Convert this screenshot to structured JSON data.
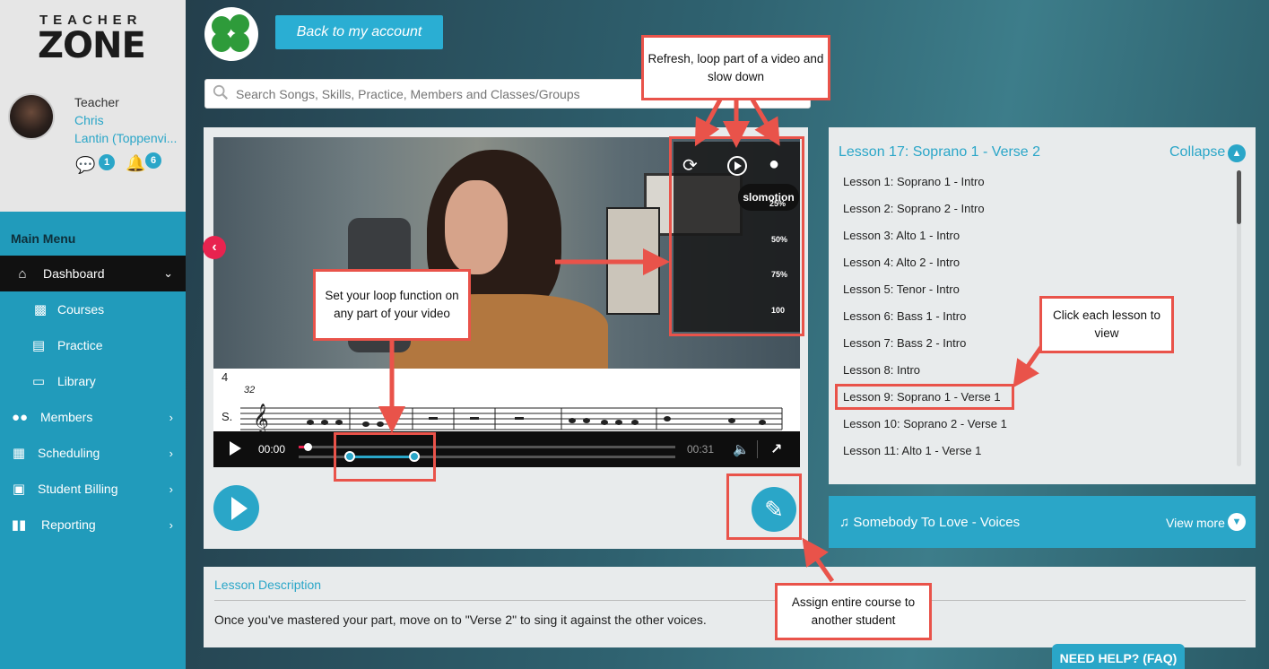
{
  "brand": {
    "logo_top": "TEACHER",
    "logo_main": "ZONE"
  },
  "user": {
    "role": "Teacher",
    "name_line1": "Chris",
    "name_line2": "Lantin (Toppenvi...",
    "messages_count": "1",
    "notifications_count": "6"
  },
  "menu": {
    "title": "Main Menu",
    "items": [
      {
        "label": "Dashboard",
        "icon": "home-icon"
      },
      {
        "label": "Courses",
        "icon": "book-icon"
      },
      {
        "label": "Practice",
        "icon": "document-icon"
      },
      {
        "label": "Library",
        "icon": "file-icon"
      },
      {
        "label": "Members",
        "icon": "users-icon"
      },
      {
        "label": "Scheduling",
        "icon": "calendar-icon"
      },
      {
        "label": "Student Billing",
        "icon": "cart-icon"
      },
      {
        "label": "Reporting",
        "icon": "bar-chart-icon"
      }
    ]
  },
  "header": {
    "back_button": "Back to my account",
    "search_placeholder": "Search Songs, Skills, Practice, Members and Classes/Groups"
  },
  "player": {
    "current_time": "00:00",
    "duration": "00:31",
    "slomo_tooltip": "slomotion",
    "speeds": [
      "25%",
      "50%",
      "75%",
      "100"
    ],
    "sheet_measure": "4",
    "sheet_bar": "32",
    "sheet_part": "S."
  },
  "lessons": {
    "current": "Lesson 17: Soprano 1 - Verse 2",
    "collapse_label": "Collapse",
    "items": [
      "Lesson 1: Soprano 1 - Intro",
      "Lesson 2: Soprano 2 - Intro",
      "Lesson 3: Alto 1 - Intro",
      "Lesson 4: Alto 2 - Intro",
      "Lesson 5: Tenor - Intro",
      "Lesson 6: Bass 1 - Intro",
      "Lesson 7: Bass 2 - Intro",
      "Lesson 8: Intro",
      "Lesson 9: Soprano 1 - Verse 1",
      "Lesson 10: Soprano 2 - Verse 1",
      "Lesson 11: Alto 1 - Verse 1"
    ]
  },
  "song": {
    "title": "Somebody To Love - Voices",
    "view_more": "View more"
  },
  "description": {
    "title": "Lesson Description",
    "text": "Once you've mastered your part, move on to \"Verse 2\" to sing it against the other voices."
  },
  "help": {
    "label": "NEED HELP? (FAQ)"
  },
  "callouts": {
    "refresh": "Refresh, loop part of a video and slow down",
    "loop": "Set your loop function on any part of your video",
    "click_lesson": "Click each lesson to view",
    "assign": "Assign entire course to another student"
  },
  "colors": {
    "accent": "#2aa6c8",
    "callout_border": "#e9534a",
    "nav_arrow": "#e8234f",
    "active_menu": "#111111"
  }
}
